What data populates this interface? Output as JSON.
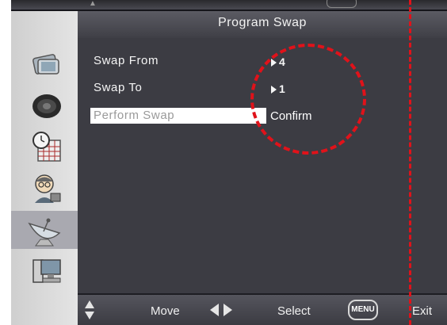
{
  "menu": {
    "title": "Program Swap",
    "rows": [
      {
        "label": "Swap From",
        "value": "4"
      },
      {
        "label": "Swap To",
        "value": "1"
      },
      {
        "label": "Perform Swap",
        "value": "Confirm"
      }
    ]
  },
  "sidebar": {
    "icons": [
      "picture-icon",
      "speaker-icon",
      "clock-calendar-icon",
      "person-lock-icon",
      "satellite-dish-icon",
      "computer-icon"
    ],
    "active_index": 4
  },
  "footer": {
    "move_label": "Move",
    "select_label": "Select",
    "menu_key": "MENU",
    "exit_label": "Exit"
  },
  "colors": {
    "annotation": "#e0121a",
    "menu_background": "#3c3c43",
    "highlight": "#ffffff"
  }
}
